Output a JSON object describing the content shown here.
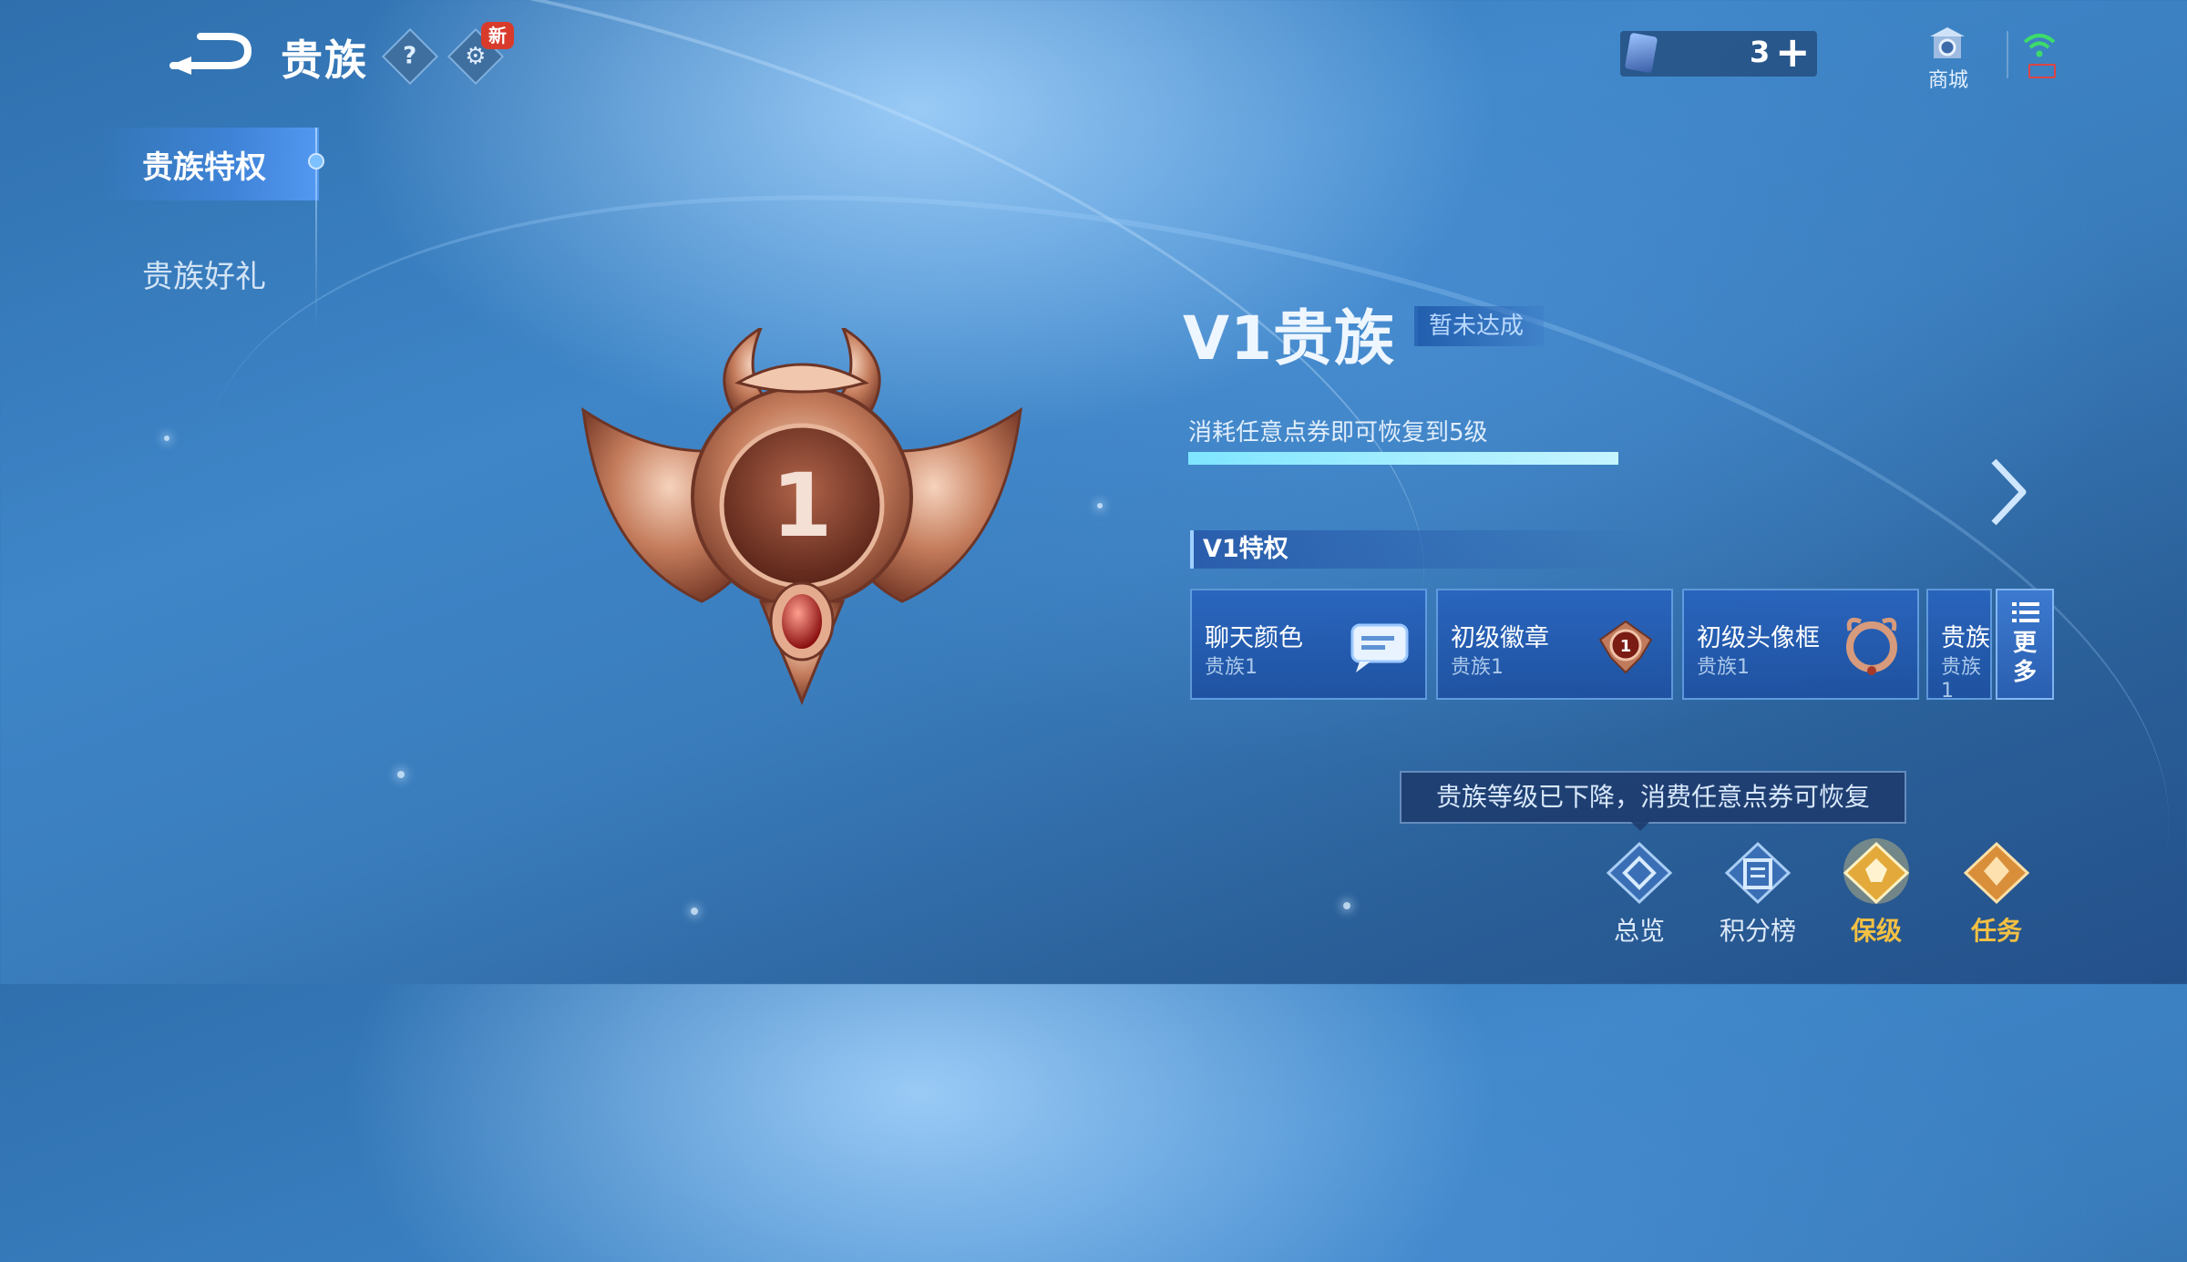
{
  "header": {
    "title": "贵族",
    "help_icon": "?",
    "new_badge": "新"
  },
  "currency": {
    "ticket_count": "3",
    "plus": "+"
  },
  "shop": {
    "label": "商城"
  },
  "sidebar": {
    "items": [
      {
        "label": "贵族特权",
        "active": true
      },
      {
        "label": "贵族好礼",
        "active": false
      }
    ]
  },
  "emblem": {
    "number": "1"
  },
  "level": {
    "title": "V1贵族",
    "status": "暂未达成",
    "hint": "消耗任意点券即可恢复到5级",
    "progress": 1.0
  },
  "privileges": {
    "header": "V1特权",
    "cards": [
      {
        "name": "聊天颜色",
        "sub": "贵族1"
      },
      {
        "name": "初级徽章",
        "sub": "贵族1"
      },
      {
        "name": "初级头像框",
        "sub": "贵族1"
      },
      {
        "name": "贵族",
        "sub": "贵族1"
      }
    ],
    "more": "更\n多"
  },
  "tooltip": "贵族等级已下降，消费任意点券可恢复",
  "bottom_nav": [
    {
      "label": "总览"
    },
    {
      "label": "积分榜"
    },
    {
      "label": "保级"
    },
    {
      "label": "任务"
    }
  ],
  "colors": {
    "accent_gold": "#f2c24a",
    "nav_gold": "#f3c043",
    "bronze": "#c67a5a"
  }
}
